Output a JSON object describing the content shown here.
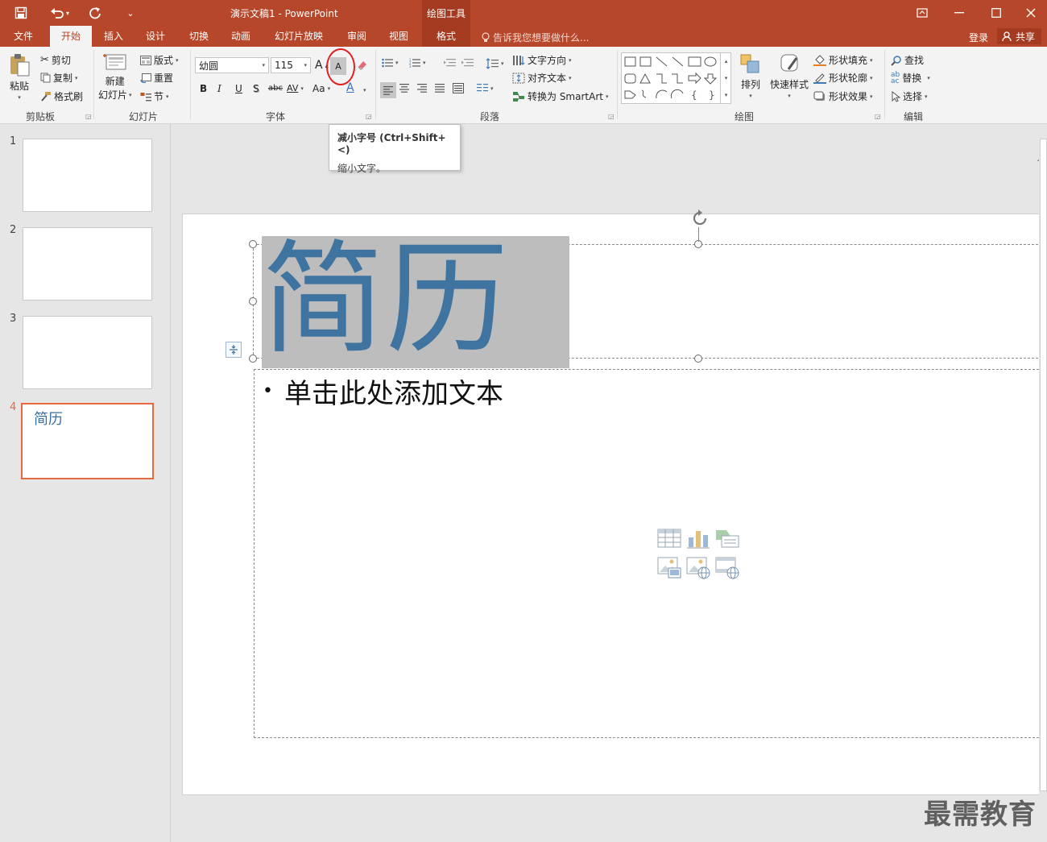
{
  "titlebar": {
    "title": "演示文稿1 - PowerPoint",
    "context_group": "绘图工具",
    "customize_caret": "⌄"
  },
  "tabs": [
    {
      "label": "文件"
    },
    {
      "label": "开始"
    },
    {
      "label": "插入"
    },
    {
      "label": "设计"
    },
    {
      "label": "切换"
    },
    {
      "label": "动画"
    },
    {
      "label": "幻灯片放映"
    },
    {
      "label": "审阅"
    },
    {
      "label": "视图"
    },
    {
      "label": "格式"
    }
  ],
  "tellme": "告诉我您想要做什么...",
  "account": {
    "login": "登录",
    "share": "共享"
  },
  "ribbon": {
    "clipboard": {
      "label": "剪贴板",
      "paste": "粘贴",
      "cut": "剪切",
      "copy": "复制",
      "format_painter": "格式刷"
    },
    "slides": {
      "label": "幻灯片",
      "new_slide_1": "新建",
      "new_slide_2": "幻灯片",
      "layout": "版式",
      "reset": "重置",
      "section": "节"
    },
    "font": {
      "label": "字体",
      "font_name": "幼圆",
      "font_size": "115",
      "bold": "B",
      "italic": "I",
      "underline": "U",
      "shadow": "S",
      "strike": "abc",
      "spacing": "AV",
      "case": "Aa",
      "color_a": "A",
      "grow": "A",
      "shrink": "A"
    },
    "paragraph": {
      "label": "段落",
      "text_direction": "文字方向",
      "align_text": "对齐文本",
      "convert_smartart": "转换为 SmartArt"
    },
    "drawing": {
      "label": "绘图",
      "arrange": "排列",
      "quick_styles": "快速样式",
      "shape_fill": "形状填充",
      "shape_outline": "形状轮廓",
      "shape_effects": "形状效果"
    },
    "editing": {
      "label": "编辑",
      "find": "查找",
      "replace": "替换",
      "select": "选择"
    }
  },
  "tooltip": {
    "title": "减小字号 (Ctrl+Shift+<)",
    "desc": "缩小文字。"
  },
  "thumbnails": [
    {
      "num": "1",
      "title": ""
    },
    {
      "num": "2",
      "title": ""
    },
    {
      "num": "3",
      "title": ""
    },
    {
      "num": "4",
      "title": "简历"
    }
  ],
  "slide": {
    "title": "简历",
    "body_placeholder": "单击此处添加文本",
    "bullet": "•"
  },
  "watermark": "最需教育",
  "colors": {
    "accent": "#b7472a",
    "title_text": "#3f73a0",
    "active_thumb": "#e8683f"
  }
}
